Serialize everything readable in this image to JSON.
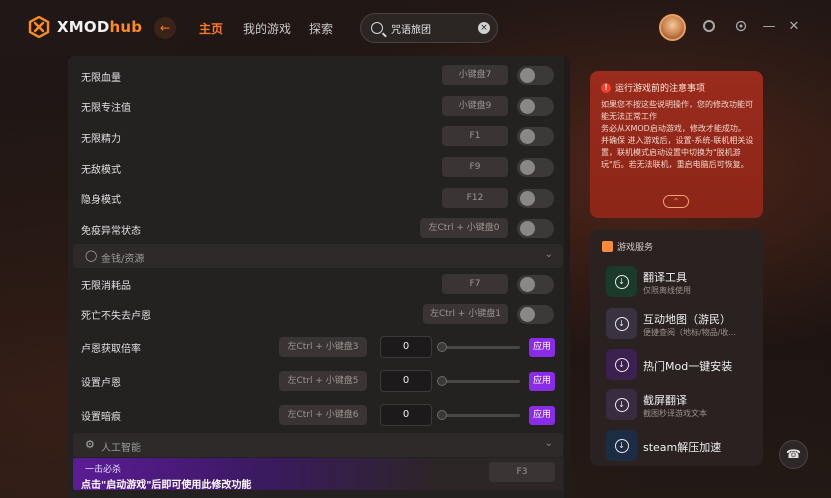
{
  "app": {
    "logo_text_main": "XMOD",
    "logo_text_accent": "hub",
    "accent_color": "#ff7a24",
    "apply_color": "#8a2be8"
  },
  "nav": {
    "items": [
      {
        "label": "主页",
        "active": true
      },
      {
        "label": "我的游戏",
        "active": false
      },
      {
        "label": "探索",
        "active": false
      }
    ]
  },
  "search": {
    "value": "咒语旅团"
  },
  "mods": {
    "top_rows": [
      {
        "label": "无限血量",
        "key": "小键盘7"
      },
      {
        "label": "无限专注值",
        "key": "小键盘9"
      },
      {
        "label": "无限精力",
        "key": "F1"
      },
      {
        "label": "无敌模式",
        "key": "F9"
      },
      {
        "label": "隐身模式",
        "key": "F12"
      },
      {
        "label": "免疫异常状态",
        "key": "左Ctrl + 小键盘0"
      }
    ],
    "section_money": {
      "title": "金钱/资源"
    },
    "money_rows": [
      {
        "label": "无限消耗品",
        "key": "F7"
      },
      {
        "label": "死亡不失去卢恩",
        "key": "左Ctrl + 小键盘1"
      }
    ],
    "value_rows": [
      {
        "label": "卢恩获取倍率",
        "key": "左Ctrl + 小键盘3",
        "value": "0",
        "apply": "应用"
      },
      {
        "label": "设置卢恩",
        "key": "左Ctrl + 小键盘5",
        "value": "0",
        "apply": "应用"
      },
      {
        "label": "设置暗痕",
        "key": "左Ctrl + 小键盘6",
        "value": "0",
        "apply": "应用"
      }
    ],
    "section_ai": {
      "title": "人工智能"
    },
    "banner": {
      "line1": "一击必杀",
      "line2": "点击\"启动游戏\"后即可使用此修改功能",
      "key": "F3"
    }
  },
  "notice": {
    "title": "运行游戏前的注意事项",
    "body": "如果您不按这些说明操作，您的修改功能可能无法正常工作\n务必从XMOD启动游戏，修改才能成功。\n并确保 进入游戏后，设置-系统-联机相关设置，联机模式启动设置中切换为\"脱机游玩\"后。若无法联机，重启电脑后可恢复。"
  },
  "services": {
    "title": "游戏服务",
    "items": [
      {
        "name": "翻译工具",
        "desc": "仅限离线使用"
      },
      {
        "name": "互动地图（游民）",
        "desc": "便捷查阅（地标/物品/收..."
      },
      {
        "name": "热门Mod一键安装",
        "desc": ""
      },
      {
        "name": "截屏翻译",
        "desc": "截图秒译游戏文本"
      },
      {
        "name": "steam解压加速",
        "desc": ""
      }
    ]
  }
}
